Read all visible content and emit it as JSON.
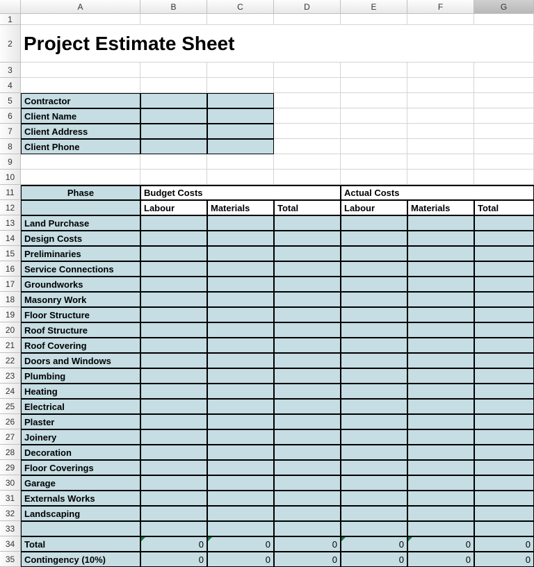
{
  "columns": [
    "A",
    "B",
    "C",
    "D",
    "E",
    "F",
    "G"
  ],
  "rows": [
    "1",
    "2",
    "3",
    "4",
    "5",
    "6",
    "7",
    "8",
    "9",
    "10",
    "11",
    "12",
    "13",
    "14",
    "15",
    "16",
    "17",
    "18",
    "19",
    "20",
    "21",
    "22",
    "23",
    "24",
    "25",
    "26",
    "27",
    "28",
    "29",
    "30",
    "31",
    "32",
    "33",
    "34",
    "35"
  ],
  "title": "Project Estimate Sheet",
  "info": {
    "contractor": "Contractor",
    "client_name": "Client Name",
    "client_address": "Client Address",
    "client_phone": "Client Phone"
  },
  "headers": {
    "phase": "Phase",
    "budget": "Budget Costs",
    "actual": "Actual Costs",
    "labour": "Labour",
    "materials": "Materials",
    "total": "Total"
  },
  "phases": [
    "Land Purchase",
    "Design Costs",
    "Preliminaries",
    "Service Connections",
    "Groundworks",
    "Masonry Work",
    "Floor Structure",
    "Roof Structure",
    "Roof Covering",
    "Doors and Windows",
    "Plumbing",
    "Heating",
    "Electrical",
    "Plaster",
    "Joinery",
    "Decoration",
    "Floor Coverings",
    "Garage",
    "Externals Works",
    "Landscaping"
  ],
  "totals": {
    "total_label": "Total",
    "contingency_label": "Contingency (10%)",
    "values": [
      "0",
      "0",
      "0",
      "0",
      "0",
      "0"
    ]
  }
}
